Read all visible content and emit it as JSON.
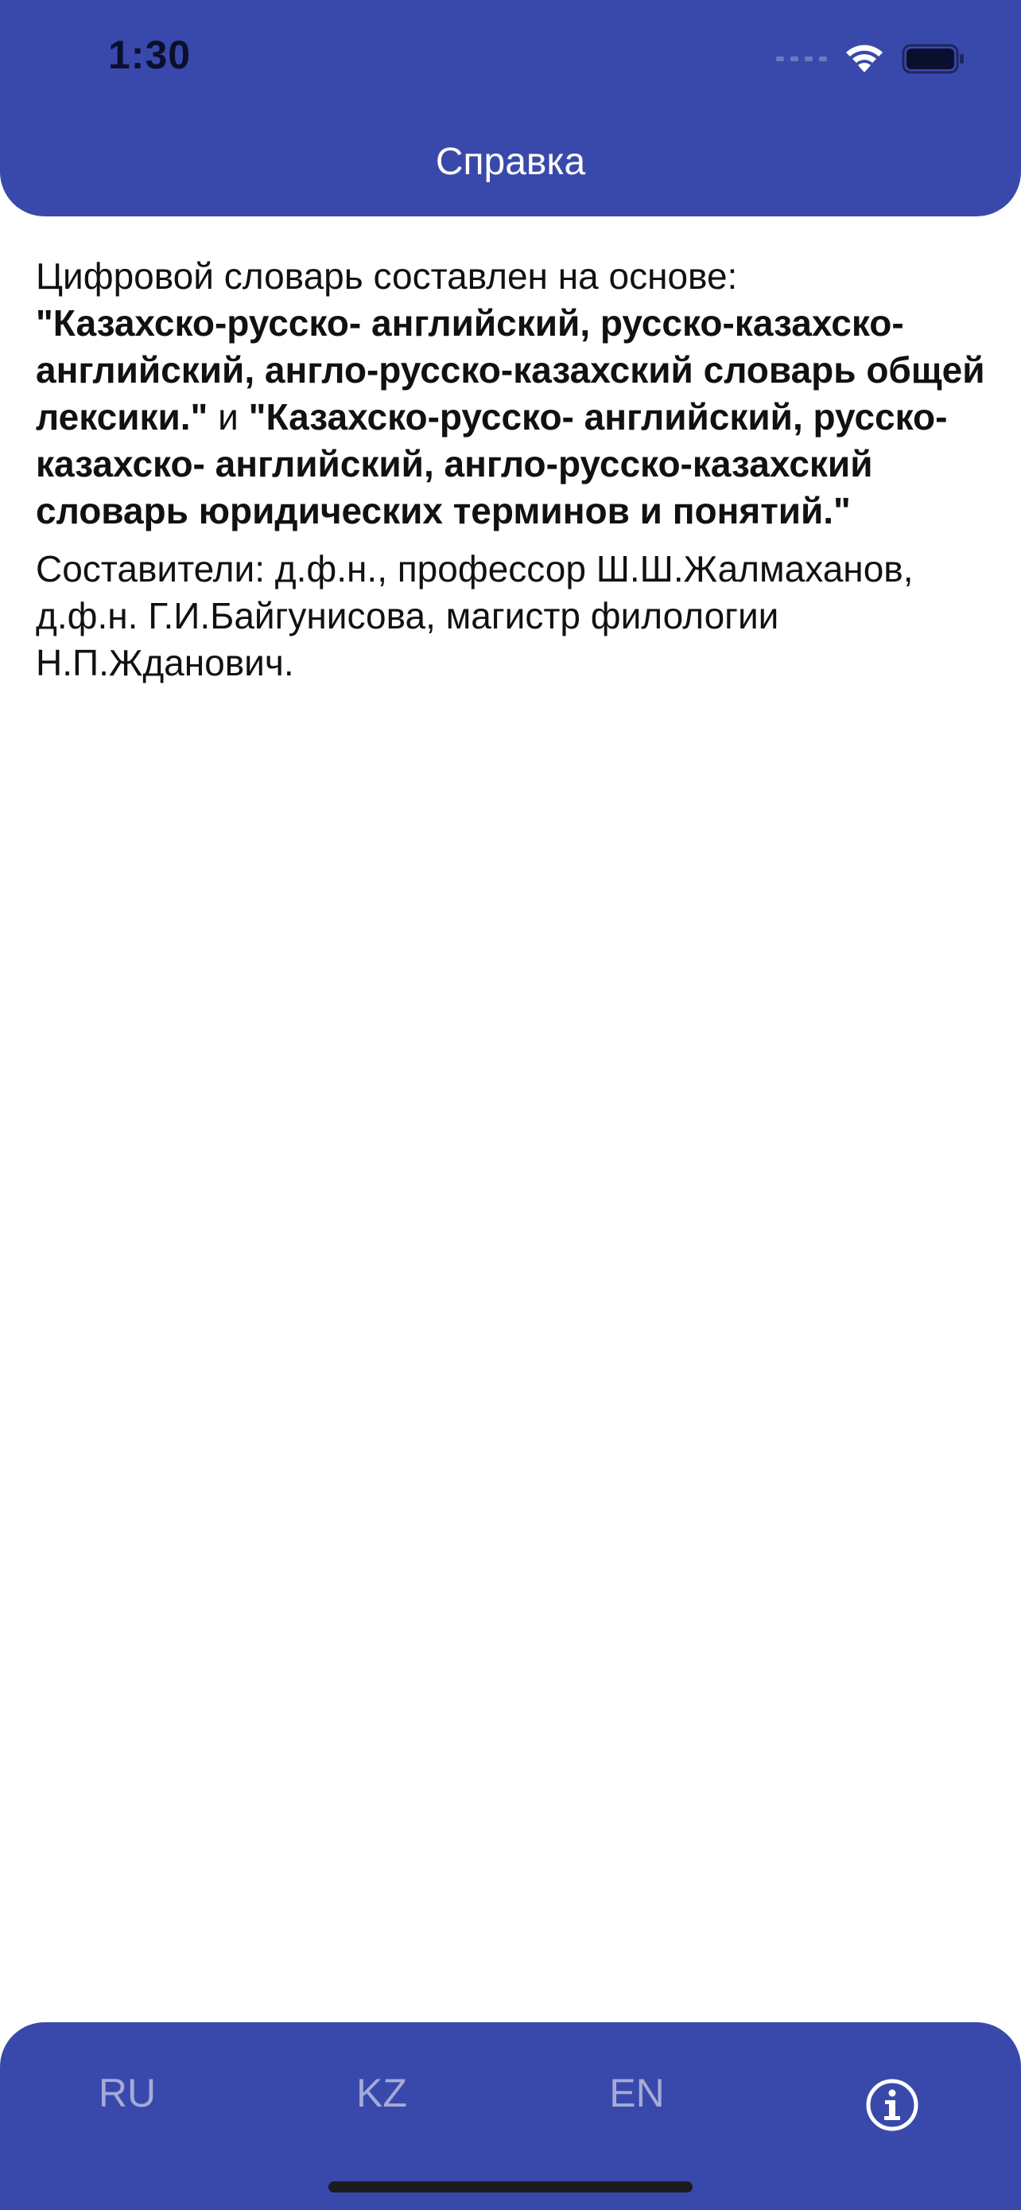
{
  "status_bar": {
    "time": "1:30",
    "icons": [
      "cellular-signal-icon",
      "wifi-icon",
      "battery-icon"
    ]
  },
  "header": {
    "title": "Справка"
  },
  "content": {
    "intro": "Цифровой словарь составлен на основе:",
    "book1": "\"Казахско-русско- английский, русско-казахско-английский, англо-русско-казахский словарь общей лексики.\"",
    "conjunction": " и ",
    "book2": "\"Казахско-русско- английский, русско-казахско- английский, англо-русско-казахский словарь юридических терминов и понятий.\"",
    "authors": "Составители: д.ф.н., профессор Ш.Ш.Жалмаханов, д.ф.н. Г.И.Байгунисова, магистр филологии Н.П.Жданович."
  },
  "tabbar": {
    "tabs": [
      {
        "label": "RU"
      },
      {
        "label": "KZ"
      },
      {
        "label": "EN"
      }
    ],
    "info_icon": "info-icon"
  },
  "colors": {
    "primary": "#3949AB",
    "tab_inactive": "#a5abd7",
    "tab_active": "#ffffff",
    "text": "#111111"
  }
}
